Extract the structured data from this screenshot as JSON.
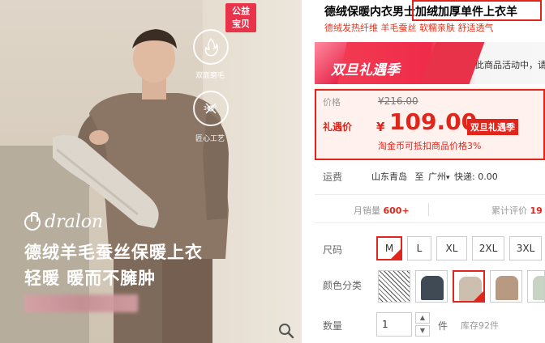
{
  "product_image": {
    "badge": "公益宝贝",
    "feature1_label": "双面磨毛",
    "feature2_label": "匠心工艺",
    "feature2_badge_text": "360°",
    "brand": "dralon",
    "headline1": "德绒羊毛蚕丝保暖上衣",
    "headline2": "轻暖 暖而不臃肿"
  },
  "title": "德绒保暖内衣男士加绒加厚单件上衣羊",
  "subtitle": "德绒发热纤维 羊毛蚕丝 软糯亲肤 舒适透气",
  "promo_banner": {
    "title": "双旦礼遇季",
    "active_text": "此商品活动中，请"
  },
  "price": {
    "orig_label": "价格",
    "orig_value": "¥216.00",
    "promo_label": "礼遇价",
    "currency": "¥",
    "value": "109.00",
    "tag": "双旦礼遇季",
    "coin_note": "淘金币可抵扣商品价格3%"
  },
  "shipping": {
    "label": "运费",
    "from": "山东青岛",
    "to_prefix": "至",
    "to": "广州",
    "fee": "快递: 0.00"
  },
  "stats": {
    "monthly_label": "月销量",
    "monthly_value": "600+",
    "reviews_label": "累计评价",
    "reviews_value": "19"
  },
  "size": {
    "label": "尺码",
    "options": [
      "M",
      "L",
      "XL",
      "2XL",
      "3XL"
    ],
    "selected": "M"
  },
  "color": {
    "label": "颜色分类",
    "swatch_colors": [
      "#888888",
      "#3f4a55",
      "#cdbfb0",
      "#b89a82",
      "#c8d3c4"
    ],
    "selected_index": 2
  },
  "quantity": {
    "label": "数量",
    "value": "1",
    "unit": "件",
    "stock": "库存92件"
  },
  "colors": {
    "accent": "#e1251b",
    "shirt_main": "#8b7666"
  }
}
